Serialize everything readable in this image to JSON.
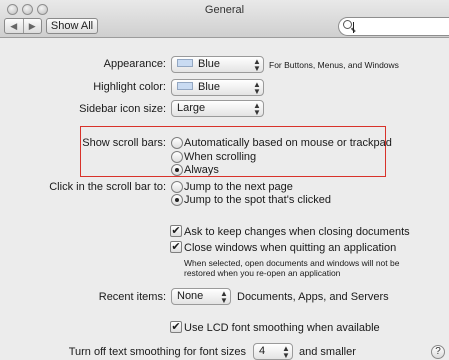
{
  "window": {
    "title": "General"
  },
  "toolbar": {
    "back_glyph": "◀",
    "forward_glyph": "▶",
    "show_all_label": "Show All",
    "search_value": ""
  },
  "appearance": {
    "label": "Appearance:",
    "value": "Blue",
    "note": "For Buttons, Menus, and Windows"
  },
  "highlight": {
    "label": "Highlight color:",
    "value": "Blue"
  },
  "sidebar_icon": {
    "label": "Sidebar icon size:",
    "value": "Large"
  },
  "scroll_bars": {
    "label": "Show scroll bars:",
    "options": [
      "Automatically based on mouse or trackpad",
      "When scrolling",
      "Always"
    ],
    "selected": 2
  },
  "scroll_click": {
    "label": "Click in the scroll bar to:",
    "options": [
      "Jump to the next page",
      "Jump to the spot that's clicked"
    ],
    "selected": 1
  },
  "ask_changes": {
    "label": "Ask to keep changes when closing documents",
    "checked": true
  },
  "close_windows": {
    "label": "Close windows when quitting an application",
    "checked": true,
    "note_line1": "When selected, open documents and windows will not be",
    "note_line2": "restored when you re-open an application"
  },
  "recent_items": {
    "label": "Recent items:",
    "value": "None",
    "suffix": "Documents, Apps, and Servers"
  },
  "lcd_smoothing": {
    "label": "Use LCD font smoothing when available",
    "checked": true
  },
  "text_smoothing": {
    "label": "Turn off text smoothing for font sizes",
    "value": "4",
    "suffix": "and smaller"
  },
  "help": {
    "glyph": "?"
  },
  "icons": {
    "checkmark": "✔",
    "arrows_up": "▲",
    "arrows_down": "▼"
  },
  "colors": {
    "highlight_border": "#d8322a",
    "swatch_blue": "#c9dbf2"
  }
}
